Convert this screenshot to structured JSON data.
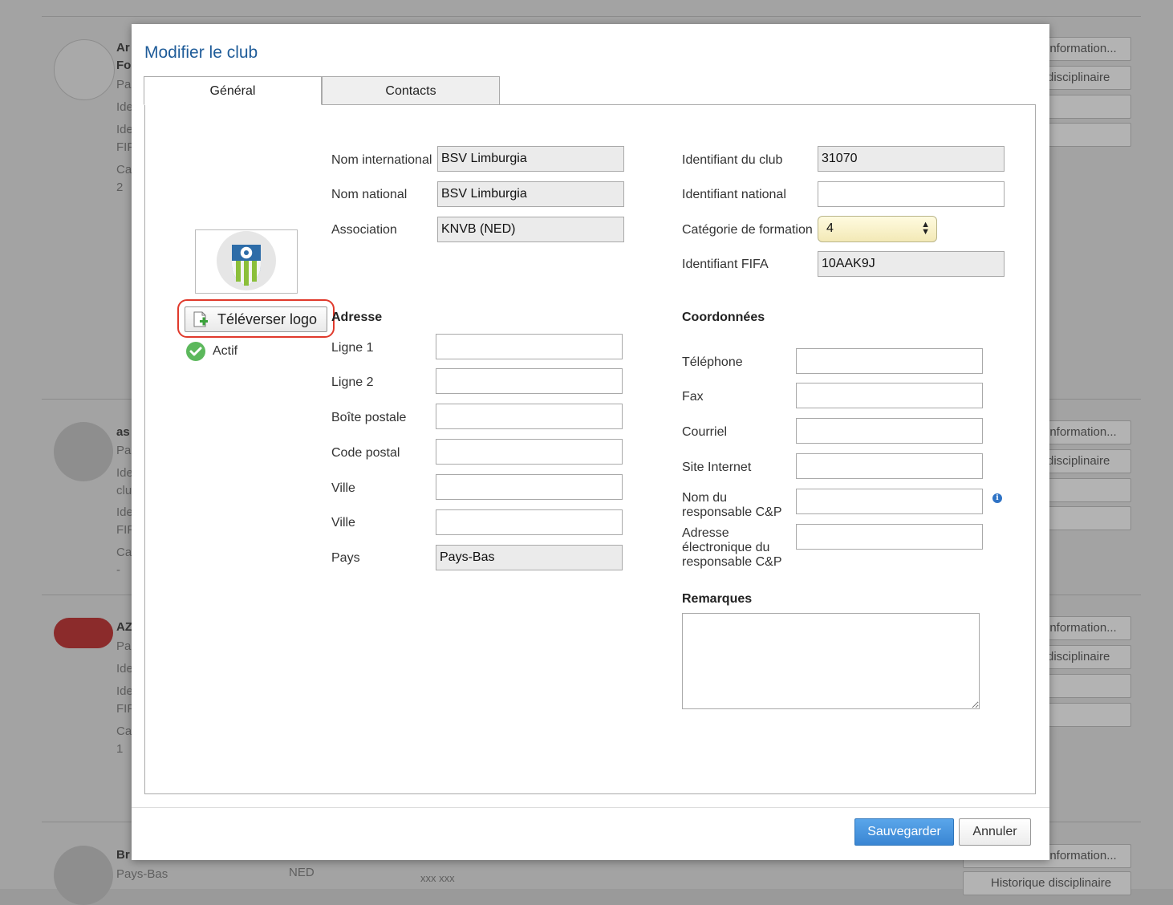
{
  "background": {
    "row1": {
      "name": "Ar",
      "name2": "Fo",
      "lines": [
        "Pa",
        "Ide",
        "Ide",
        "FIF",
        "Ca",
        "2"
      ],
      "buttons": [
        "information...",
        "disciplinaire"
      ]
    },
    "row2": {
      "name": "as",
      "lines": [
        "Pa",
        "Ide",
        "clu",
        "Ide",
        "FIF",
        "Ca",
        "-"
      ],
      "buttons": [
        "information...",
        "disciplinaire"
      ]
    },
    "row3": {
      "name": "AZ",
      "lines": [
        "Pa",
        "Ide",
        "Ide",
        "FIF",
        "Ca",
        "1"
      ],
      "buttons": [
        "information...",
        "disciplinaire"
      ]
    },
    "row4": {
      "name": "Br",
      "country": "Pays-Bas",
      "code": "NED",
      "phone": "xxx xxx",
      "buttons": [
        "information...",
        "Historique disciplinaire"
      ]
    }
  },
  "modal": {
    "title": "Modifier le club",
    "tabs": [
      {
        "label": "Général",
        "active": true
      },
      {
        "label": "Contacts",
        "active": false
      }
    ],
    "upload_label": "Téléverser logo",
    "active_label": "Actif",
    "fields": {
      "nom_international": {
        "label": "Nom international",
        "value": "BSV Limburgia"
      },
      "nom_national": {
        "label": "Nom national",
        "value": "BSV Limburgia"
      },
      "association": {
        "label": "Association",
        "value": "KNVB (NED)"
      },
      "identifiant_club": {
        "label": "Identifiant du club",
        "value": "31070"
      },
      "identifiant_national": {
        "label": "Identifiant national",
        "value": ""
      },
      "categorie_formation": {
        "label": "Catégorie de formation",
        "value": "4"
      },
      "identifiant_fifa": {
        "label": "Identifiant FIFA",
        "value": "10AAK9J"
      }
    },
    "adresse": {
      "title": "Adresse",
      "ligne1": "Ligne 1",
      "ligne2": "Ligne 2",
      "boite_postale": "Boîte postale",
      "code_postal": "Code postal",
      "ville1": "Ville",
      "ville2": "Ville",
      "pays_label": "Pays",
      "pays_value": "Pays-Bas"
    },
    "coordonnees": {
      "title": "Coordonnées",
      "telephone": "Téléphone",
      "fax": "Fax",
      "courriel": "Courriel",
      "site": "Site Internet",
      "nom_responsable": "Nom du responsable C&P",
      "adresse_responsable": "Adresse électronique du responsable C&P"
    },
    "remarques_title": "Remarques",
    "save_label": "Sauvegarder",
    "cancel_label": "Annuler"
  },
  "colors": {
    "title_blue": "#1f5c99",
    "save_blue": "#3a86d3",
    "highlight_red": "#e03a2c",
    "active_green": "#5cb85c"
  }
}
